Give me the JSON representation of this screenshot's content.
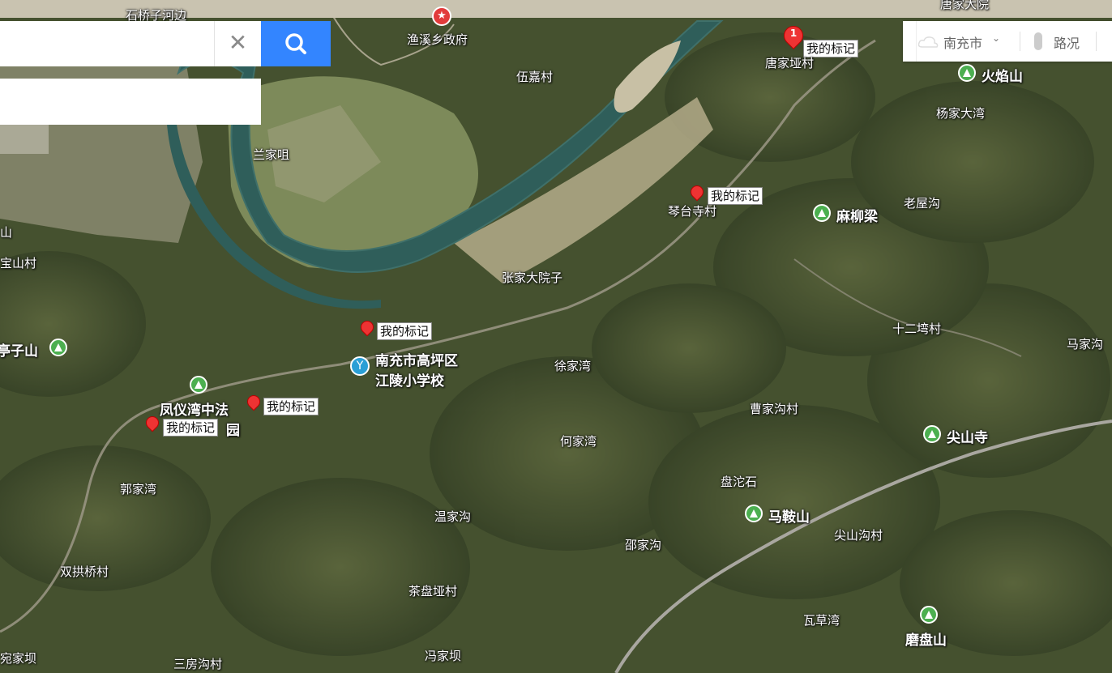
{
  "search": {
    "query": "",
    "suggestion": ""
  },
  "toolbar": {
    "city": "南充市",
    "traffic": "路况"
  },
  "marker_label": "我的标记",
  "numbered_marker": "1",
  "top_partial_labels": {
    "left": "石桥子河边",
    "right": "唐家大院"
  },
  "gov_poi": "渔溪乡政府",
  "school_poi": {
    "line1": "南充市高坪区",
    "line2": "江陵小学校"
  },
  "park_poi": {
    "name": "凤仪湾中法",
    "suffix": "园"
  },
  "mountains": [
    "火焰山",
    "麻柳梁",
    "亭子山",
    "尖山寺",
    "马鞍山",
    "磨盘山"
  ],
  "places": [
    "伍嘉村",
    "兰家咀",
    "唐家垭村",
    "杨家大湾",
    "琴台寺村",
    "老屋沟",
    "张家大院子",
    "宝山村",
    "山",
    "十二塆村",
    "马家沟",
    "徐家湾",
    "曹家沟村",
    "何家湾",
    "盘沱石",
    "郭家湾",
    "温家沟",
    "尖山沟村",
    "邵家沟",
    "双拱桥村",
    "茶盘垭村",
    "瓦草湾",
    "宛家坝",
    "三房沟村",
    "冯家坝"
  ]
}
